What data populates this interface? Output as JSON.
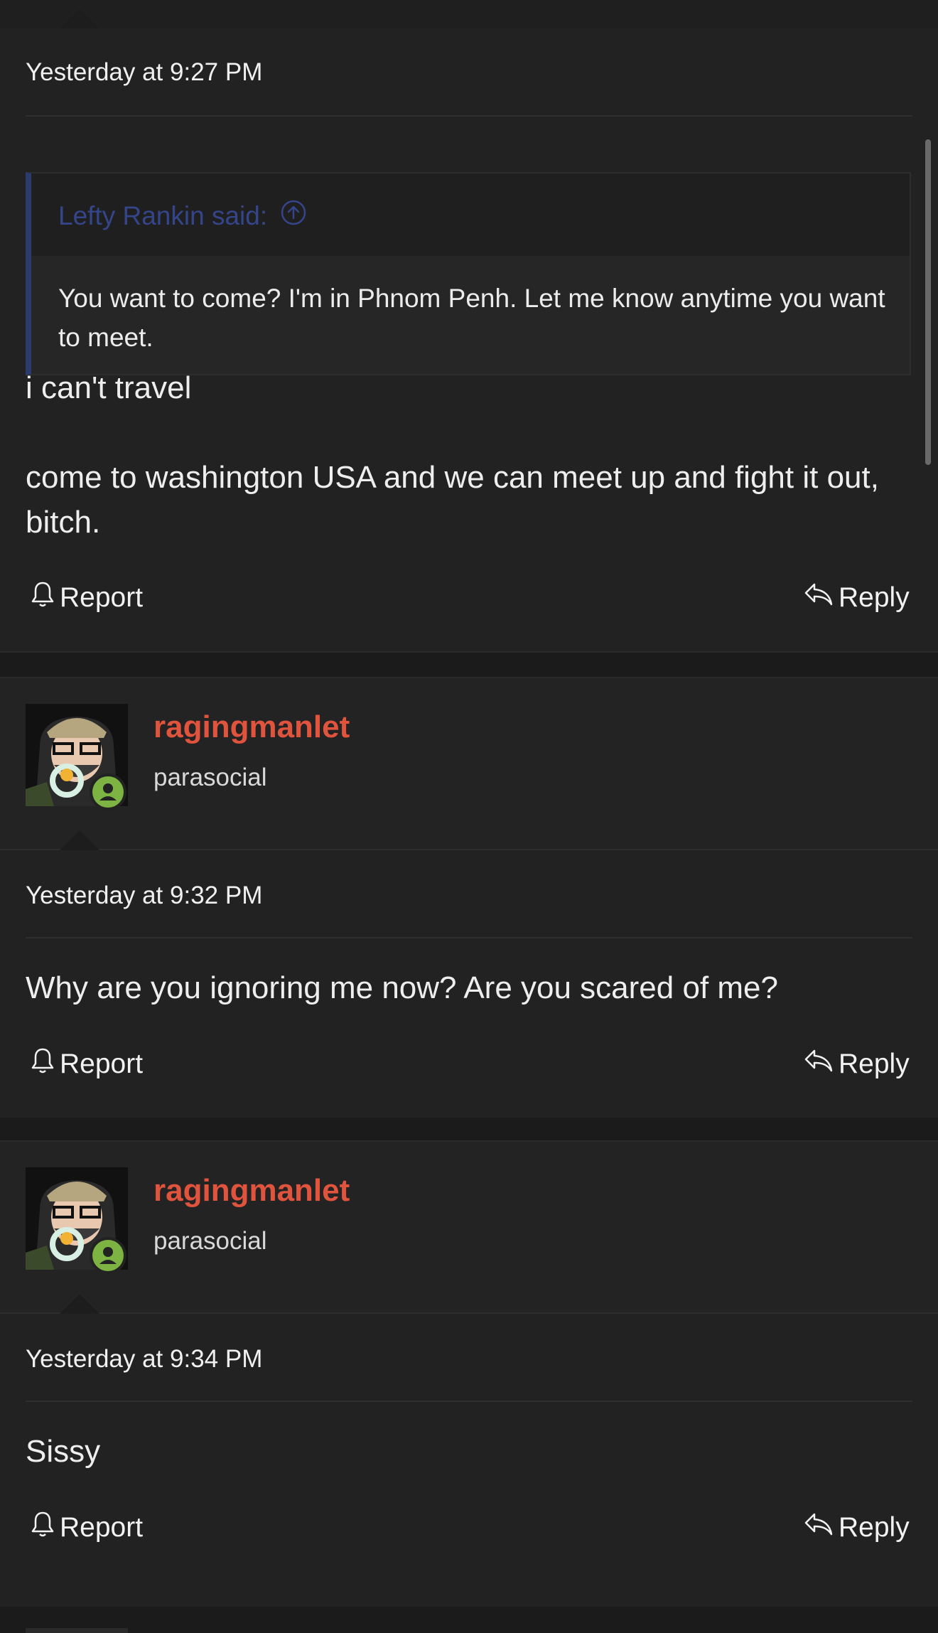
{
  "posts": [
    {
      "timestamp": "Yesterday at 9:27 PM",
      "quote": {
        "author": "Lefty Rankin said:",
        "text": "You want to come? I'm in Phnom Penh. Let me know anytime you want to meet."
      },
      "paragraphs": [
        "i can't travel",
        "come to washington USA and we can meet up and fight it out, bitch."
      ],
      "report_label": "Report",
      "reply_label": "Reply"
    },
    {
      "username": "ragingmanlet",
      "user_title": "parasocial",
      "timestamp": "Yesterday at 9:32 PM",
      "paragraphs": [
        "Why are you ignoring me now? Are you scared of me?"
      ],
      "report_label": "Report",
      "reply_label": "Reply"
    },
    {
      "username": "ragingmanlet",
      "user_title": "parasocial",
      "timestamp": "Yesterday at 9:34 PM",
      "paragraphs": [
        "Sissy"
      ],
      "report_label": "Report",
      "reply_label": "Reply"
    }
  ],
  "colors": {
    "username": "#e0533d",
    "quote_author": "#35458a",
    "online_status": "#7cb342"
  },
  "icons": {
    "report": "bell-icon",
    "reply": "reply-arrow-icon",
    "quote_jump": "arrow-up-circle-icon",
    "online": "user-online-icon"
  }
}
